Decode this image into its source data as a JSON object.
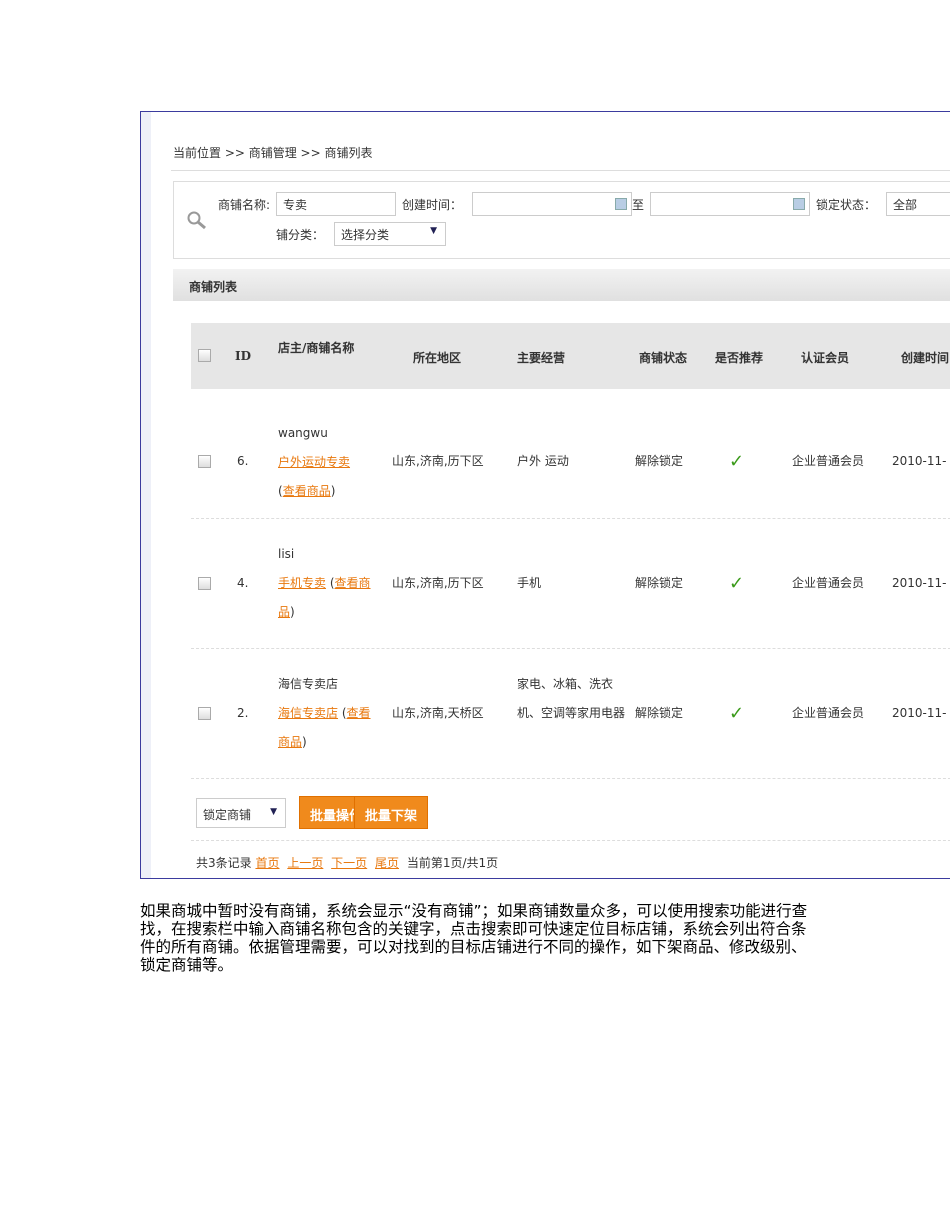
{
  "breadcrumb": "当前位置 >> 商铺管理 >> 商铺列表",
  "search": {
    "name_label": "商铺名称:",
    "name_value": "专卖",
    "time_label": "创建时间：",
    "to_label": "至",
    "lock_label": "锁定状态：",
    "lock_value": "全部",
    "category_label": "铺分类：",
    "category_value": "选择分类"
  },
  "list_title": "商铺列表",
  "columns": [
    "ID",
    "店主/商铺名称",
    "所在地区",
    "主要经营",
    "商铺状态",
    "是否推荐",
    "认证会员",
    "创建时间"
  ],
  "rows": [
    {
      "id": "6.",
      "owner": "wangwu",
      "shop": "户外运动专卖",
      "view": "查看商品",
      "region": "山东,济南,历下区",
      "business": "户外 运动",
      "status": "解除锁定",
      "member": "企业普通会员",
      "time": "2010-11-"
    },
    {
      "id": "4.",
      "owner": "lisi",
      "shop": "手机专卖",
      "view": "查看商品",
      "region": "山东,济南,历下区",
      "business": "手机",
      "status": "解除锁定",
      "member": "企业普通会员",
      "time": "2010-11-"
    },
    {
      "id": "2.",
      "owner": "海信专卖店",
      "shop": "海信专卖店",
      "view": "查看商品",
      "region": "山东,济南,天桥区",
      "business": "家电、冰箱、洗衣机、空调等家用电器",
      "status": "解除锁定",
      "member": "企业普通会员",
      "time": "2010-11-"
    }
  ],
  "actions": {
    "select_value": "锁定商铺",
    "batch_op": "批量操作",
    "batch_off": "批量下架"
  },
  "pager": {
    "total": "共3条记录",
    "first": "首页",
    "prev": "上一页",
    "next": "下一页",
    "last": "尾页",
    "current": "当前第1页/共1页"
  },
  "paragraph": "如果商城中暂时没有商铺，系统会显示“没有商铺”；如果商铺数量众多，可以使用搜索功能进行查找，在搜索栏中输入商铺名称包含的关键字，点击搜索即可快速定位目标店铺，系统会列出符合条件的所有商铺。依据管理需要，可以对找到的目标店铺进行不同的操作，如下架商品、修改级别、锁定商铺等。"
}
